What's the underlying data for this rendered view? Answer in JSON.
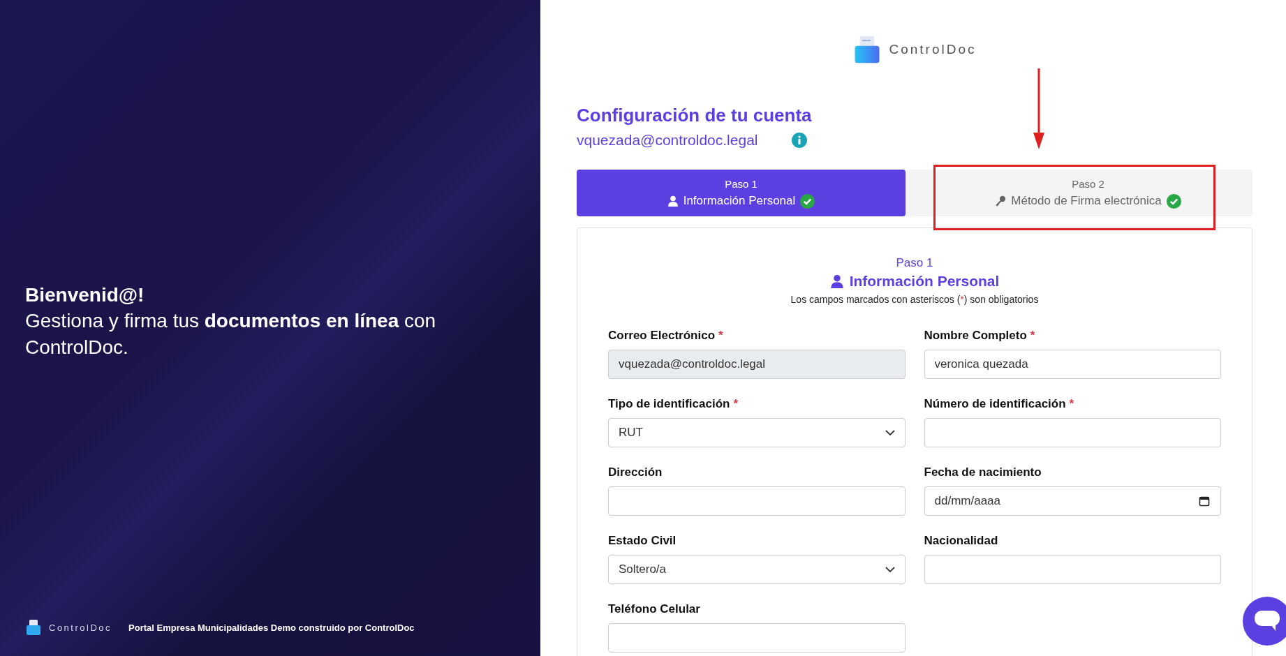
{
  "hero": {
    "greeting": "Bienvenid@!",
    "message": "Gestiona y firma tus **documentos en línea** con ControlDoc."
  },
  "footer": {
    "logo_text": "ControlDoc",
    "caption": "Portal Empresa Municipalidades Demo construido por ControlDoc"
  },
  "header": {
    "logo_text": "ControlDoc",
    "title": "Configuración de tu cuenta",
    "email": "vquezada@controldoc.legal"
  },
  "steps": [
    {
      "step": "Paso 1",
      "label": "Información Personal",
      "kind": "person",
      "selected": true,
      "done": true
    },
    {
      "step": "Paso 2",
      "label": "Método de Firma electrónica",
      "kind": "key",
      "selected": false,
      "done": true
    }
  ],
  "form": {
    "step": "Paso 1",
    "title": "Información Personal",
    "note_before": "Los campos marcados con asteriscos (",
    "note_mark": "*",
    "note_after": ") son obligatorios",
    "fields": [
      {
        "label": "Correo Electrónico",
        "mark": "*",
        "kind": "text",
        "value": "vquezada@controldoc.legal",
        "disabled": true
      },
      {
        "label": "Nombre Completo",
        "mark": "*",
        "kind": "text",
        "value": "veronica quezada",
        "disabled": false
      },
      {
        "label": "Tipo de identificación",
        "mark": "*",
        "kind": "select",
        "value": "RUT"
      },
      {
        "label": "Número de identificación",
        "mark": "*",
        "kind": "text",
        "disabled": false
      },
      {
        "label": "Dirección",
        "kind": "text",
        "disabled": false
      },
      {
        "label": "Fecha de nacimiento",
        "kind": "date",
        "placeholder": "dd/mm/aaaa"
      },
      {
        "label": "Estado Civil",
        "kind": "select",
        "value": "Soltero/a"
      },
      {
        "label": "Nacionalidad",
        "kind": "text",
        "disabled": false
      },
      {
        "label": "Teléfono Celular",
        "kind": "text",
        "disabled": false
      }
    ]
  }
}
